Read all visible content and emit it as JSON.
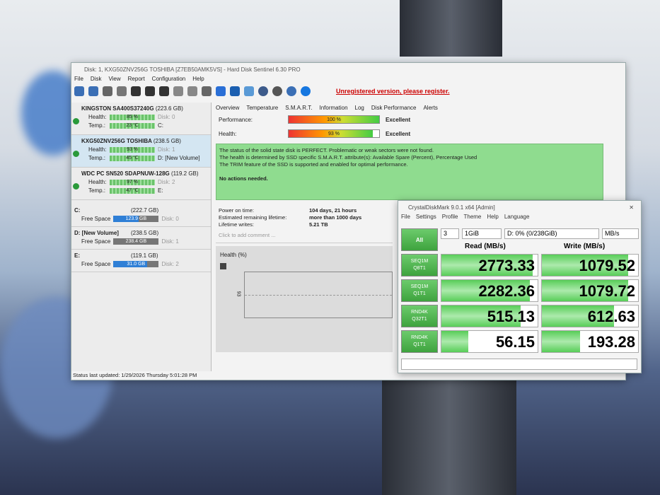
{
  "hds": {
    "title": "Disk: 1, KXG50ZNV256G TOSHIBA [Z7EB50AMK5VS]  -  Hard Disk Sentinel 6.30 PRO",
    "menu": [
      "File",
      "Disk",
      "View",
      "Report",
      "Configuration",
      "Help"
    ],
    "register_notice": "Unregistered version, please register.",
    "disks": [
      {
        "name": "KINGSTON SA400S37240G",
        "size": "(223.6 GB)",
        "health_label": "Health:",
        "health": "85 %",
        "health_value": 85,
        "temp_label": "Temp.:",
        "temp": "23 °C",
        "disk": "Disk: 0",
        "drive": "C:"
      },
      {
        "name": "KXG50ZNV256G TOSHIBA",
        "size": "(238.5 GB)",
        "health_label": "Health:",
        "health": "93 %",
        "health_value": 93,
        "temp_label": "Temp.:",
        "temp": "45 °C",
        "disk": "Disk: 1",
        "drive": "D: [New Volume]"
      },
      {
        "name": "WDC PC SN520 SDAPNUW-128G",
        "size": "(119.2 GB)",
        "health_label": "Health:",
        "health": "97 %",
        "health_value": 97,
        "temp_label": "Temp.:",
        "temp": "47 °C",
        "disk": "Disk: 2",
        "drive": "E:"
      }
    ],
    "volumes": [
      {
        "name": "C:",
        "size": "(222.7 GB)",
        "free_label": "Free Space",
        "free": "123.9 GB",
        "free_pct": 55,
        "disk": "Disk: 0"
      },
      {
        "name": "D: [New Volume]",
        "size": "(238.5 GB)",
        "free_label": "Free Space",
        "free": "238.4 GB",
        "free_pct": 0,
        "disk": "Disk: 1"
      },
      {
        "name": "E:",
        "size": "(119.1 GB)",
        "free_label": "Free Space",
        "free": "31.0 GB",
        "free_pct": 74,
        "disk": "Disk: 2"
      }
    ],
    "tabs": [
      "Overview",
      "Temperature",
      "S.M.A.R.T.",
      "Information",
      "Log",
      "Disk Performance",
      "Alerts"
    ],
    "performance": {
      "label": "Performance:",
      "value": "100 %",
      "rating": "Excellent"
    },
    "health": {
      "label": "Health:",
      "value": "93 %",
      "rating": "Excellent"
    },
    "status_lines": [
      "The status of the solid state disk is PERFECT. Problematic or weak sectors were not found.",
      "The health is determined by SSD specific S.M.A.R.T. attribute(s):  Available Spare (Percent), Percentage Used",
      "The TRIM feature of the SSD is supported and enabled for optimal performance."
    ],
    "status_action": "No actions needed.",
    "info": [
      {
        "k": "Power on time:",
        "v": "104 days, 21 hours"
      },
      {
        "k": "Estimated remaining lifetime:",
        "v": "more than 1000 days"
      },
      {
        "k": "Lifetime writes:",
        "v": "5.21 TB"
      }
    ],
    "comment_placeholder": "Click to add comment ...",
    "chart_title": "Health (%)",
    "chart_tick": "93",
    "status_bar": "Status last updated: 1/29/2026 Thursday 5:01:28 PM"
  },
  "cdm": {
    "title": "CrystalDiskMark 9.0.1 x64 [Admin]",
    "menu": [
      "File",
      "Settings",
      "Profile",
      "Theme",
      "Help",
      "Language"
    ],
    "all": "All",
    "count": "3",
    "size": "1GiB",
    "drive": "D: 0% (0/238GiB)",
    "unit": "MB/s",
    "read_header": "Read (MB/s)",
    "write_header": "Write (MB/s)",
    "rows": [
      {
        "l1": "SEQ1M",
        "l2": "Q8T1",
        "read": "2773.33",
        "write": "1079.52"
      },
      {
        "l1": "SEQ1M",
        "l2": "Q1T1",
        "read": "2282.36",
        "write": "1079.72"
      },
      {
        "l1": "RND4K",
        "l2": "Q32T1",
        "read": "515.13",
        "write": "612.63"
      },
      {
        "l1": "RND4K",
        "l2": "Q1T1",
        "read": "56.15",
        "write": "193.28"
      }
    ]
  }
}
